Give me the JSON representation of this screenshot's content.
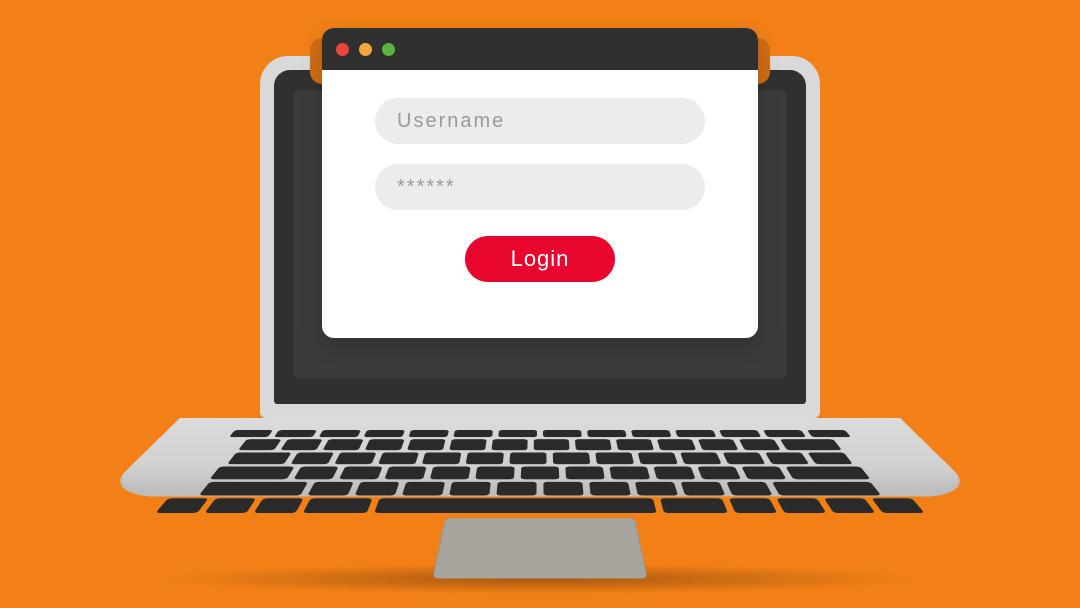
{
  "colors": {
    "background": "#f28017",
    "button": "#e8062f",
    "traffic_light": {
      "close": "#e9453a",
      "minimize": "#f2a73b",
      "zoom": "#58b43f"
    }
  },
  "form": {
    "username": {
      "placeholder": "Username",
      "value": ""
    },
    "password": {
      "placeholder": "******",
      "value": ""
    },
    "login_label": "Login"
  }
}
